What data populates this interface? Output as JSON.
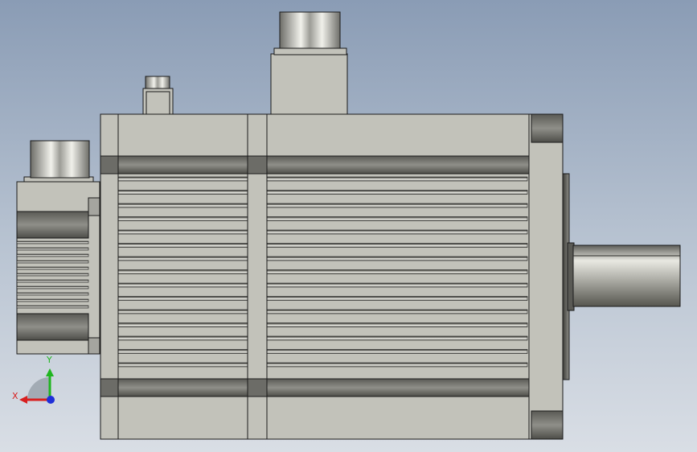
{
  "viewport": {
    "background_top": "#8a9cb5",
    "background_bottom": "#d9dee5"
  },
  "model": {
    "body_color": "#c2c2ba",
    "edge_color": "#1a1a1a",
    "dark_band_color": "#8b8b85",
    "fin_dark_color": "#6a6a66",
    "fin_light_color": "#e3e3dc"
  },
  "triad": {
    "x_label": "X",
    "y_label": "Y",
    "x_color": "#d81f1f",
    "y_color": "#1fb51f",
    "z_color": "#1f2fd8"
  }
}
